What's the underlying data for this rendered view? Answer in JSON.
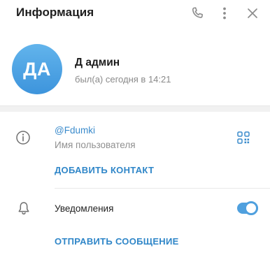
{
  "header": {
    "title": "Информация",
    "call_icon": "phone-icon",
    "more_icon": "vertical-dots-icon",
    "close_icon": "close-icon"
  },
  "profile": {
    "avatar_initials": "ДА",
    "avatar_color": "#4fa6e6",
    "name": "Д админ",
    "status": "был(а) сегодня в 14:21"
  },
  "info": {
    "icon": "info-circle-icon",
    "username": "@Fdumki",
    "username_label": "Имя пользователя",
    "qr_icon": "qr-code-icon",
    "add_contact_label": "ДОБАВИТЬ КОНТАКТ"
  },
  "notifications": {
    "icon": "bell-icon",
    "label": "Уведомления",
    "enabled": true
  },
  "actions": {
    "send_message_label": "ОТПРАВИТЬ СООБЩЕНИЕ"
  },
  "colors": {
    "accent": "#2f86c8",
    "link": "#3a8bcc",
    "toggle": "#4fa0de",
    "muted_text": "#8a8a8a"
  }
}
